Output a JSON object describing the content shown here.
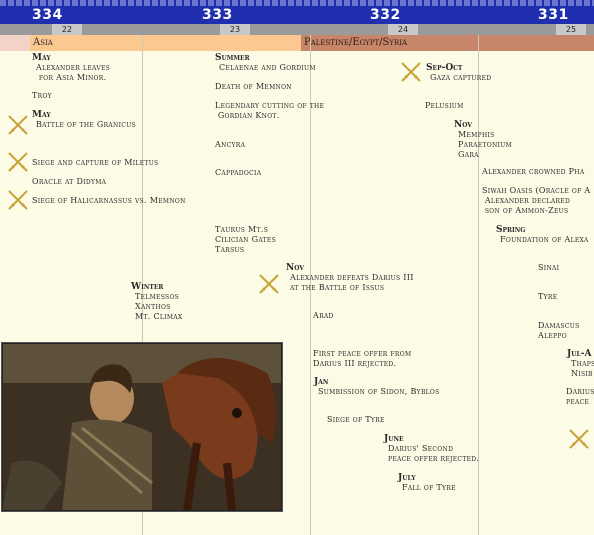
{
  "years": [
    "334",
    "333",
    "332",
    "331"
  ],
  "ruler_ticks": [
    "22",
    "23",
    "24",
    "25"
  ],
  "bands": {
    "asia": "Asia",
    "palestine": "Palestine/Egypt/Syria"
  },
  "col1": {
    "may1_head": "May",
    "may1_text": "Alexander leaves\n for Asia Minor.",
    "troy": "Troy",
    "may2_head": "May",
    "granicus": "Battle of the Granicus",
    "miletus": "Siege and capture of Miletus",
    "didyma": "Oracle at Didyma",
    "halicarnassus": "Siege of Halicarnassus vs. Memnon",
    "winter_head": "Winter",
    "winter_text": "Telmessos\nXanthos\nMt. Climax"
  },
  "col2": {
    "summer_head": "Summer",
    "summer_text": "Celaenae and Gordium",
    "memnon": "Death of Memnon",
    "gordian": "Legendary cutting of the\n Gordian Knot.",
    "ancyra": "Ancyra",
    "cappadocia": "Cappadocia",
    "taurus": "Taurus Mt.s\nCilician Gates\nTarsus",
    "nov_head": "Nov",
    "issus": "Alexander defeats Darius III\nat the Battle of Issus"
  },
  "col3": {
    "sepoct_head": "Sep-Oct",
    "gaza": "Gaza captured",
    "pelusium": "Pelusium",
    "nov_head": "Nov",
    "memphis": "Memphis\nParaetonium\nGara",
    "arad": "Arad",
    "peace1": "First peace offer from\nDarius III rejected.",
    "jan_head": "Jan",
    "sidon": "Sumbission of Sidon, Byblos",
    "tyre_siege": "Siege of Tyre",
    "june_head": "June",
    "peace2": "Darius' Second\npeace offer rejected.",
    "july_head": "July",
    "fall_tyre": "Fall of Tyre"
  },
  "col4": {
    "crowned": "Alexander crowned Pha",
    "siwah": "Siwah Oasis (Oracle of A\n Alexander declared\n son of Ammon-Zeus",
    "spring_head": "Spring",
    "foundation": "Foundation of Alexa",
    "sinai": "Sinai",
    "tyre": "Tyre",
    "damascus": "Damascus\nAleppo",
    "jul_head": "Jul-A",
    "thaps": "Thaps\nNisib",
    "darius": "Darius\npeace"
  },
  "colors": {
    "topbar": "#1f2fb0",
    "asia_band": "#fbc98f",
    "palestine_band": "#c7866a",
    "background": "#fbfbe6",
    "sword": "#c8a23a"
  }
}
